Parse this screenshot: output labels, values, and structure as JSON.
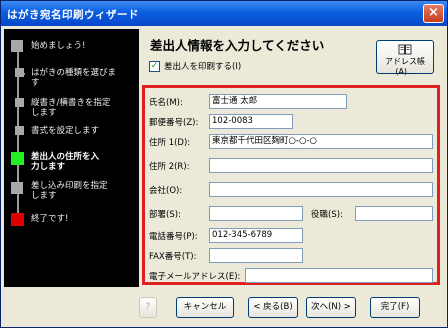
{
  "window": {
    "title": "はがき宛名印刷ウィザード",
    "close_glyph": "×"
  },
  "sidebar": {
    "steps": [
      {
        "label": "始めましょう!",
        "state": "done"
      },
      {
        "label": "はがきの種類を選びま\nす",
        "state": "done"
      },
      {
        "label": "縦書き/横書きを指定\nします",
        "state": "done"
      },
      {
        "label": "書式を設定します",
        "state": "done"
      },
      {
        "label": "差出人の住所を入\n力します",
        "state": "active"
      },
      {
        "label": "差し込み印刷を指定\nします",
        "state": "pending"
      },
      {
        "label": "終了です!",
        "state": "final"
      }
    ]
  },
  "main": {
    "heading": "差出人情報を入力してください",
    "print_sender_label": "差出人を印刷する(I)",
    "print_sender_checked": true,
    "check_glyph": "✓",
    "address_book_label": "アドレス帳(A)..."
  },
  "form": {
    "name_label": "氏名(M):",
    "name_value": "富士通 太郎",
    "zip_label": "郵便番号(Z):",
    "zip_value": "102-0083",
    "addr1_label": "住所 1(D):",
    "addr1_value": "東京都千代田区麹町○-○-○",
    "addr2_label": "住所 2(R):",
    "addr2_value": "",
    "company_label": "会社(O):",
    "company_value": "",
    "dept_label": "部署(S):",
    "dept_value": "",
    "title_label": "役職(S):",
    "title_value": "",
    "phone_label": "電話番号(P):",
    "phone_value": "012-345-6789",
    "fax_label": "FAX番号(T):",
    "fax_value": "",
    "email_label": "電子メールアドレス(E):",
    "email_value": ""
  },
  "footer": {
    "help_label": "?",
    "cancel_label": "キャンセル",
    "back_label": "< 戻る(B)",
    "next_label": "次へ(N) >",
    "finish_label": "完了(F)"
  }
}
